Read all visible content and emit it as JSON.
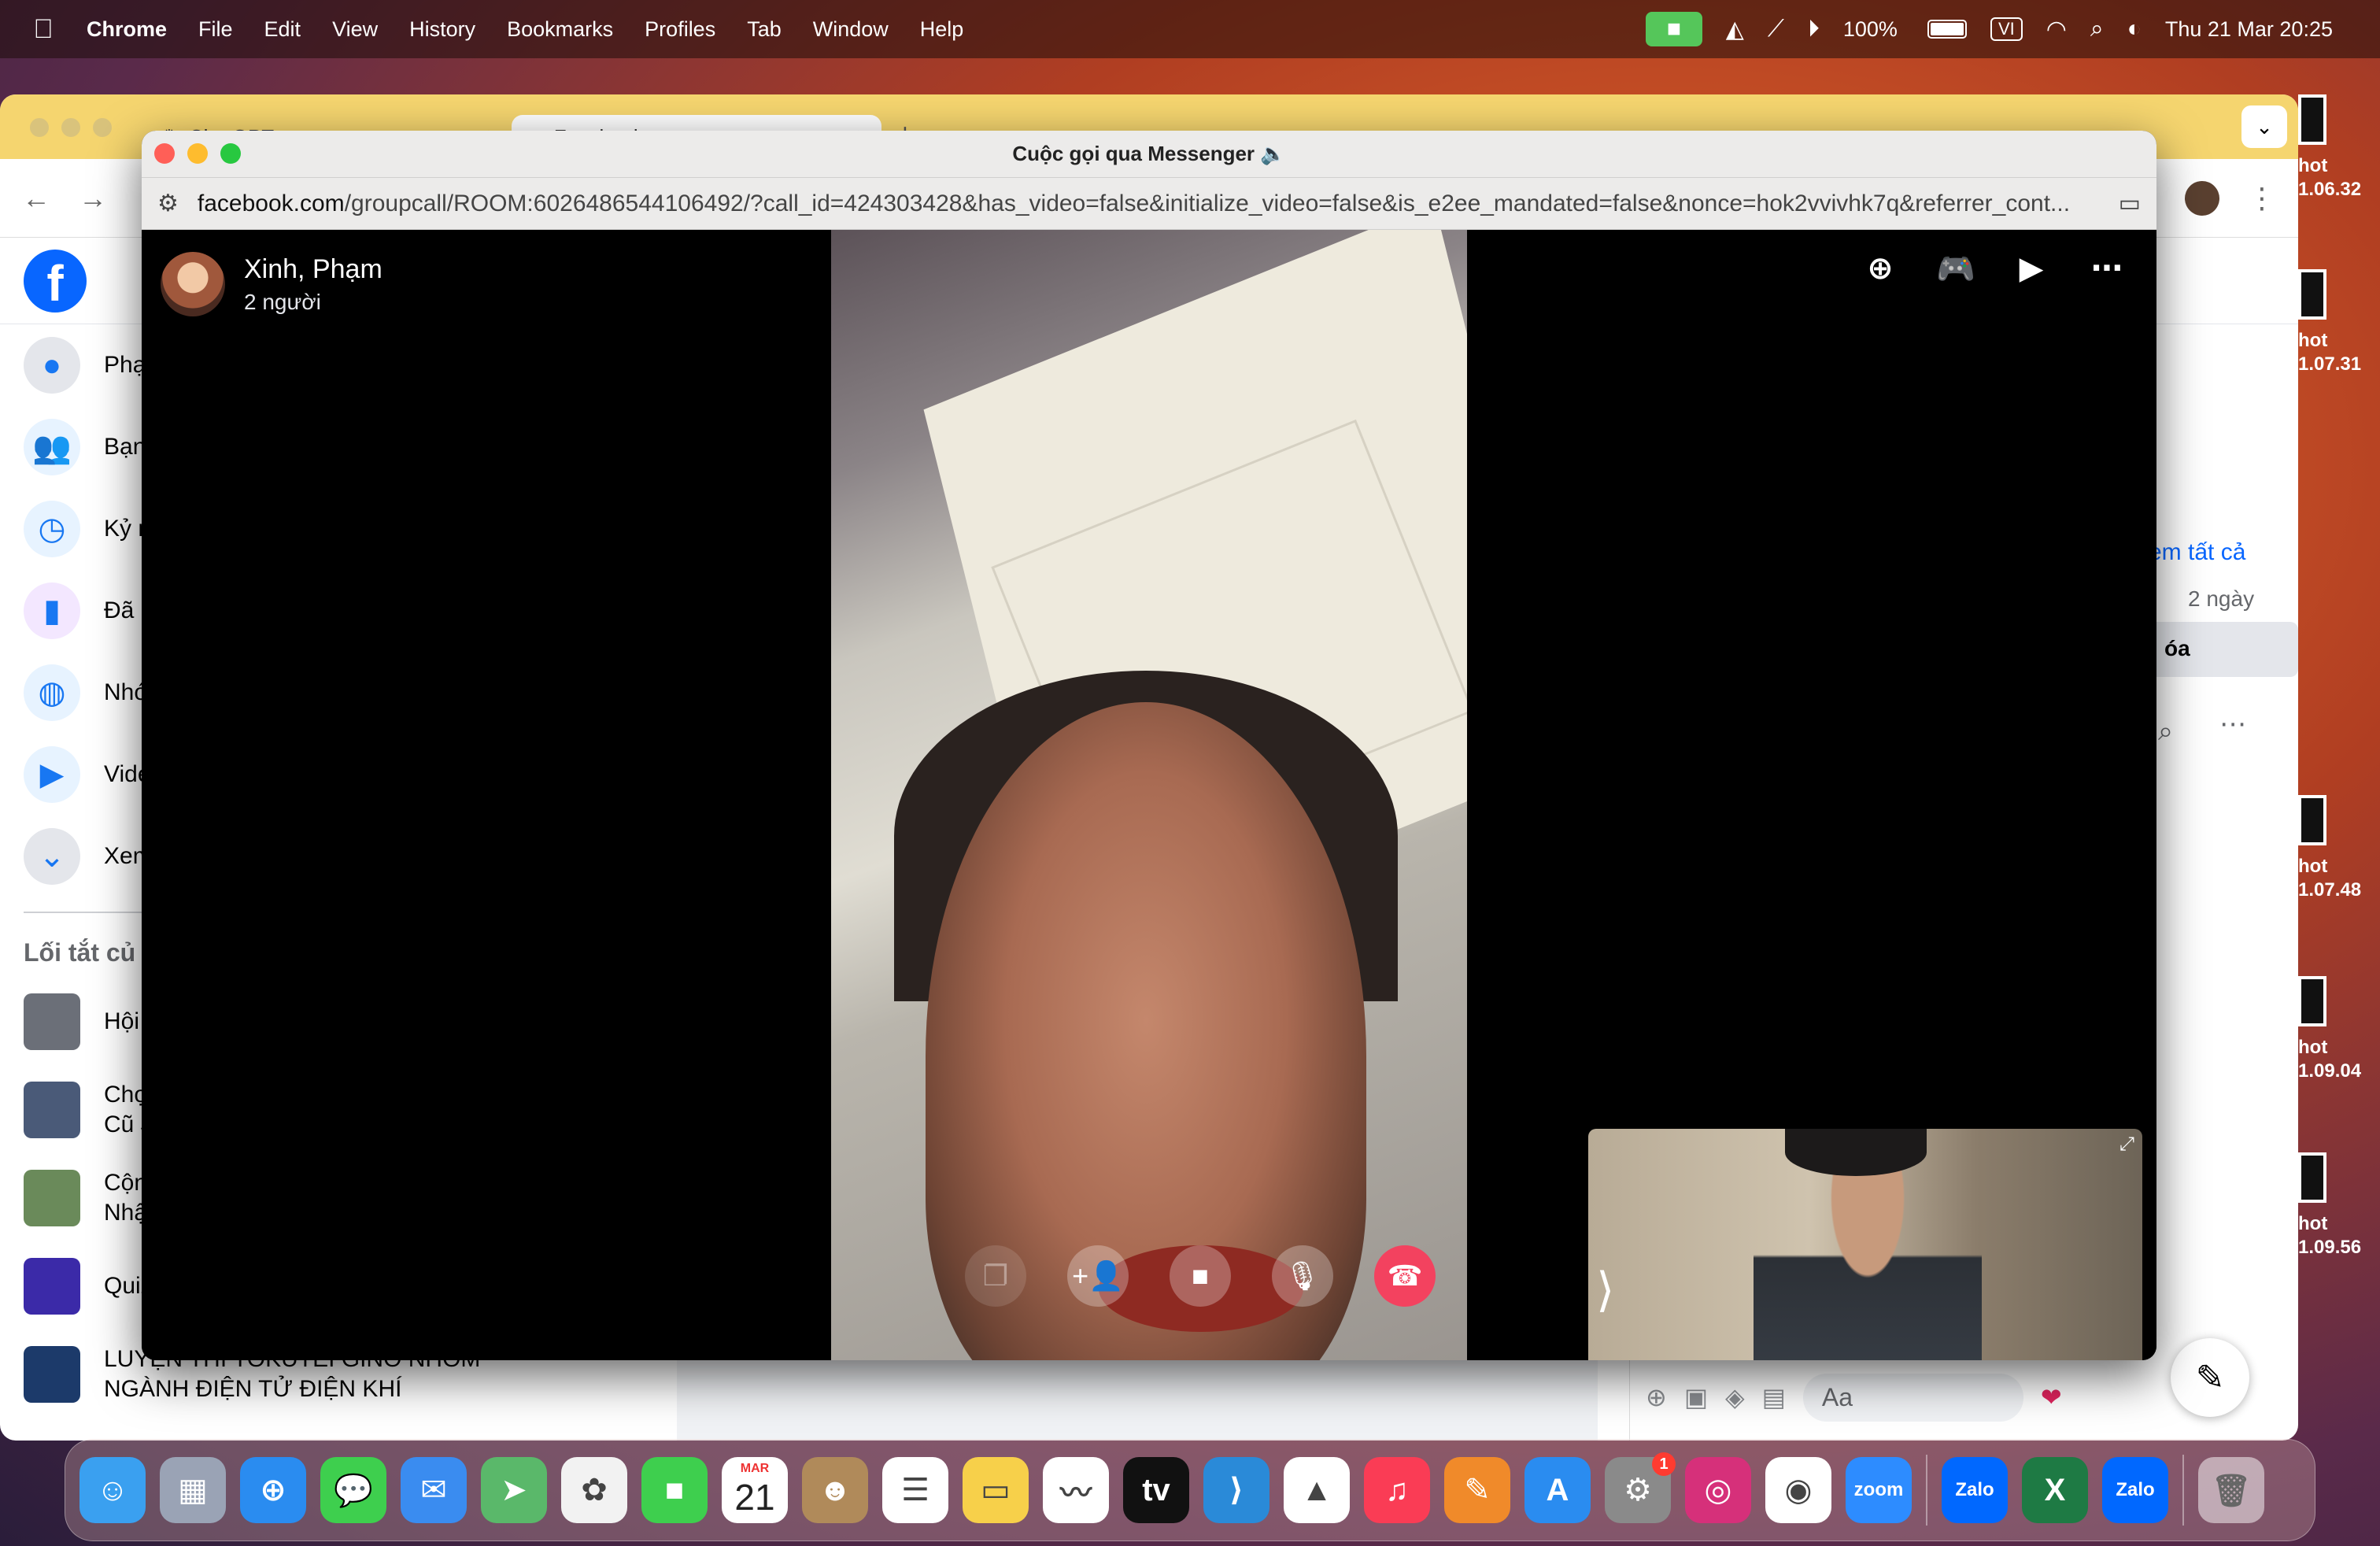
{
  "menubar": {
    "app": "Chrome",
    "items": [
      "File",
      "Edit",
      "View",
      "History",
      "Bookmarks",
      "Profiles",
      "Tab",
      "Window",
      "Help"
    ],
    "battery": "100%",
    "input_source": "VI",
    "datetime": "Thu 21 Mar  20:25"
  },
  "browser": {
    "tabs": [
      {
        "title": "ChatGPT",
        "active": false
      },
      {
        "title": "Facebook",
        "active": true
      }
    ]
  },
  "facebook": {
    "sidebar": [
      {
        "label": "Phạ",
        "icon": "profile-icon"
      },
      {
        "label": "Bạn",
        "icon": "friends-icon"
      },
      {
        "label": "Kỷ n",
        "icon": "memories-icon"
      },
      {
        "label": "Đã l",
        "icon": "saved-icon"
      },
      {
        "label": "Nhó",
        "icon": "groups-icon"
      },
      {
        "label": "Vide",
        "icon": "video-icon"
      },
      {
        "label": "Xem",
        "icon": "chevron-down-icon"
      }
    ],
    "shortcuts_heading": "Lối tắt củ",
    "shortcuts": [
      {
        "label": "Hội",
        "color": "#6b6f78"
      },
      {
        "label": "Chợ Cũ J",
        "color": "#4a5a78"
      },
      {
        "label": "Cộn Nhậ",
        "color": "#6a8a5a"
      },
      {
        "label": "Quiz",
        "color": "#3b2aa8"
      },
      {
        "label": "LUYỆN THI TOKUTEI GINO NHÓM NGÀNH ĐIỆN TỬ ĐIỆN KHÍ",
        "color": "#1c3a6a"
      }
    ],
    "right_panel": {
      "see_all": "em tất cả",
      "time": "2 ngày",
      "button_fragment": "óa"
    },
    "chat_placeholder": "Aa"
  },
  "desktop_files": [
    {
      "line1": "hot",
      "line2": "1.06.32"
    },
    {
      "line1": "hot",
      "line2": "1.07.31"
    },
    {
      "line1": "hot",
      "line2": "1.07.48"
    },
    {
      "line1": "hot",
      "line2": "1.09.04"
    },
    {
      "line1": "hot",
      "line2": "1.09.56"
    }
  ],
  "call_window": {
    "title": "Cuộc gọi qua Messenger 🔈",
    "url_host": "facebook.com",
    "url_path": "/groupcall/ROOM:6026486544106492/?call_id=424303428&has_video=false&initialize_video=false&is_e2ee_mandated=false&nonce=hok2vvivhk7q&referrer_cont...",
    "caller_name": "Xinh, Phạm",
    "participant_count": "2 người"
  },
  "dock": {
    "calendar_month": "MAR",
    "calendar_day": "21",
    "settings_badge": "1",
    "apps": [
      {
        "name": "finder",
        "color": "#3aa0f0",
        "glyph": "☺"
      },
      {
        "name": "launchpad",
        "color": "#9aa3b5",
        "glyph": "▦"
      },
      {
        "name": "safari",
        "color": "#2a8cf0",
        "glyph": "⊕"
      },
      {
        "name": "messages",
        "color": "#3ecf4e",
        "glyph": "💬"
      },
      {
        "name": "mail",
        "color": "#3a8cf0",
        "glyph": "✉"
      },
      {
        "name": "maps",
        "color": "#5ab86a",
        "glyph": "➤"
      },
      {
        "name": "photos",
        "color": "#f2f2f2",
        "glyph": "✿"
      },
      {
        "name": "facetime",
        "color": "#3ecf4e",
        "glyph": "■"
      },
      {
        "name": "calendar",
        "color": "#ffffff",
        "glyph": ""
      },
      {
        "name": "contacts",
        "color": "#b08a5a",
        "glyph": "☻"
      },
      {
        "name": "reminders",
        "color": "#ffffff",
        "glyph": "☰"
      },
      {
        "name": "notes",
        "color": "#f7d04a",
        "glyph": "▭"
      },
      {
        "name": "freeform",
        "color": "#ffffff",
        "glyph": "〰"
      },
      {
        "name": "apple-tv",
        "color": "#111111",
        "glyph": "tv"
      },
      {
        "name": "vscode",
        "color": "#2a8ad8",
        "glyph": "⟩"
      },
      {
        "name": "google-drive",
        "color": "#ffffff",
        "glyph": "▲"
      },
      {
        "name": "music",
        "color": "#fa3c55",
        "glyph": "♫"
      },
      {
        "name": "pages",
        "color": "#f08a2a",
        "glyph": "✎"
      },
      {
        "name": "app-store",
        "color": "#2a8cf0",
        "glyph": "A"
      },
      {
        "name": "system-settings",
        "color": "#8a8a8a",
        "glyph": "⚙"
      },
      {
        "name": "instagram",
        "color": "#d6307a",
        "glyph": "◎"
      },
      {
        "name": "chrome",
        "color": "#ffffff",
        "glyph": "◉"
      },
      {
        "name": "zoom",
        "color": "#2d8cff",
        "glyph": "zoom"
      }
    ],
    "apps_right": [
      {
        "name": "zalo",
        "color": "#0068ff",
        "glyph": "Zalo"
      },
      {
        "name": "excel",
        "color": "#1e7a44",
        "glyph": "X"
      },
      {
        "name": "zalo",
        "color": "#0068ff",
        "glyph": "Zalo"
      }
    ]
  }
}
